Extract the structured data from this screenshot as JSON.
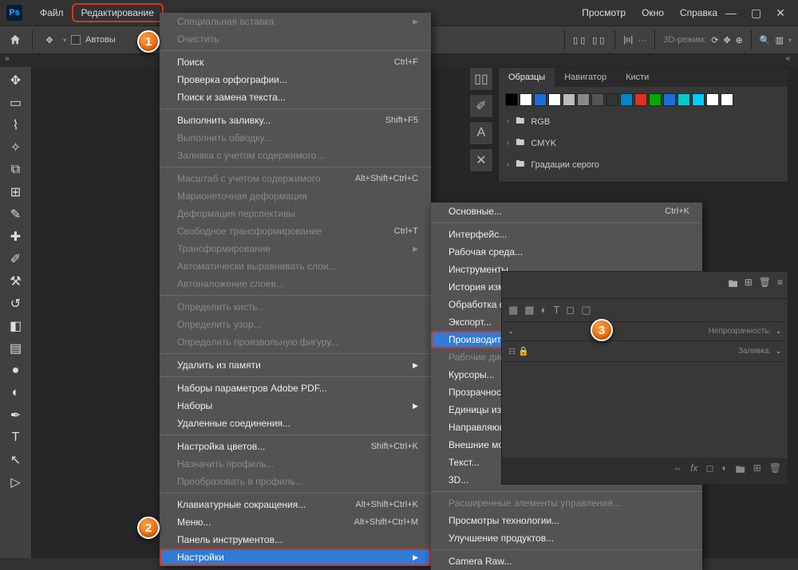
{
  "menubar": {
    "file": "Файл",
    "edit": "Редактирование",
    "view": "Просмотр",
    "window": "Окно",
    "help": "Справка"
  },
  "optbar": {
    "autoselect": "Автовы"
  },
  "mode3d": "3D-режим:",
  "edit_menu": [
    {
      "label": "Специальная вставка",
      "type": "sub",
      "disabled": true
    },
    {
      "label": "Очистить",
      "disabled": true
    },
    {
      "sep": true
    },
    {
      "label": "Поиск",
      "shortcut": "Ctrl+F"
    },
    {
      "label": "Проверка орфографии..."
    },
    {
      "label": "Поиск и замена текста..."
    },
    {
      "sep": true
    },
    {
      "label": "Выполнить заливку...",
      "shortcut": "Shift+F5"
    },
    {
      "label": "Выполнить обводку...",
      "disabled": true
    },
    {
      "label": "Заливка с учетом содержимого...",
      "disabled": true
    },
    {
      "sep": true
    },
    {
      "label": "Масштаб с учетом содержимого",
      "shortcut": "Alt+Shift+Ctrl+C",
      "disabled": true
    },
    {
      "label": "Марионеточная деформация",
      "disabled": true
    },
    {
      "label": "Деформация перспективы",
      "disabled": true
    },
    {
      "label": "Свободное трансформирование",
      "shortcut": "Ctrl+T",
      "disabled": true
    },
    {
      "label": "Трансформирование",
      "type": "sub",
      "disabled": true
    },
    {
      "label": "Автоматически выравнивать слои...",
      "disabled": true
    },
    {
      "label": "Автоналожение слоев...",
      "disabled": true
    },
    {
      "sep": true
    },
    {
      "label": "Определить кисть...",
      "disabled": true
    },
    {
      "label": "Определить узор...",
      "disabled": true
    },
    {
      "label": "Определить произвольную фигуру...",
      "disabled": true
    },
    {
      "sep": true
    },
    {
      "label": "Удалить из памяти",
      "type": "sub"
    },
    {
      "sep": true
    },
    {
      "label": "Наборы параметров Adobe PDF..."
    },
    {
      "label": "Наборы",
      "type": "sub"
    },
    {
      "label": "Удаленные соединения..."
    },
    {
      "sep": true
    },
    {
      "label": "Настройка цветов...",
      "shortcut": "Shift+Ctrl+K"
    },
    {
      "label": "Назначить профиль...",
      "disabled": true
    },
    {
      "label": "Преобразовать в профиль...",
      "disabled": true
    },
    {
      "sep": true
    },
    {
      "label": "Клавиатурные сокращения...",
      "shortcut": "Alt+Shift+Ctrl+K"
    },
    {
      "label": "Меню...",
      "shortcut": "Alt+Shift+Ctrl+M"
    },
    {
      "label": "Панель инструментов..."
    },
    {
      "label": "Настройки",
      "type": "sub",
      "sel": true,
      "boxed": true
    }
  ],
  "prefs_menu": [
    {
      "label": "Основные...",
      "shortcut": "Ctrl+K"
    },
    {
      "sep": true
    },
    {
      "label": "Интерфейс..."
    },
    {
      "label": "Рабочая среда..."
    },
    {
      "label": "Инструменты..."
    },
    {
      "label": "История изменений..."
    },
    {
      "label": "Обработка файлов..."
    },
    {
      "label": "Экспорт..."
    },
    {
      "label": "Производительность...",
      "sel": true,
      "boxed": true
    },
    {
      "label": "Рабочие диски...",
      "disabled": true
    },
    {
      "label": "Курсоры..."
    },
    {
      "label": "Прозрачность и цветовой охват..."
    },
    {
      "label": "Единицы измерения и линейки..."
    },
    {
      "label": "Направляющие, сетка и фрагменты..."
    },
    {
      "label": "Внешние модули..."
    },
    {
      "label": "Текст..."
    },
    {
      "label": "3D..."
    },
    {
      "sep": true
    },
    {
      "label": "Расширенные элементы управления...",
      "disabled": true
    },
    {
      "label": "Просмотры технологии..."
    },
    {
      "label": "Улучшение продуктов..."
    },
    {
      "sep": true
    },
    {
      "label": "Camera Raw..."
    }
  ],
  "swatches": {
    "tabs": [
      "Образцы",
      "Навигатор",
      "Кисти"
    ],
    "colors": [
      "#000",
      "#fff",
      "#1a6fd6",
      "#fff",
      "#bbb",
      "#888",
      "#555",
      "#333",
      "#08c",
      "#e03020",
      "#0a0",
      "#1a6fd6",
      "#0cc",
      "#0cf",
      "#fff",
      "#fff"
    ],
    "folders": [
      "RGB",
      "CMYK",
      "Градации серого"
    ]
  },
  "layers": {
    "opacity_label": "Непрозрачность:",
    "fill_label": "Заливка:"
  }
}
